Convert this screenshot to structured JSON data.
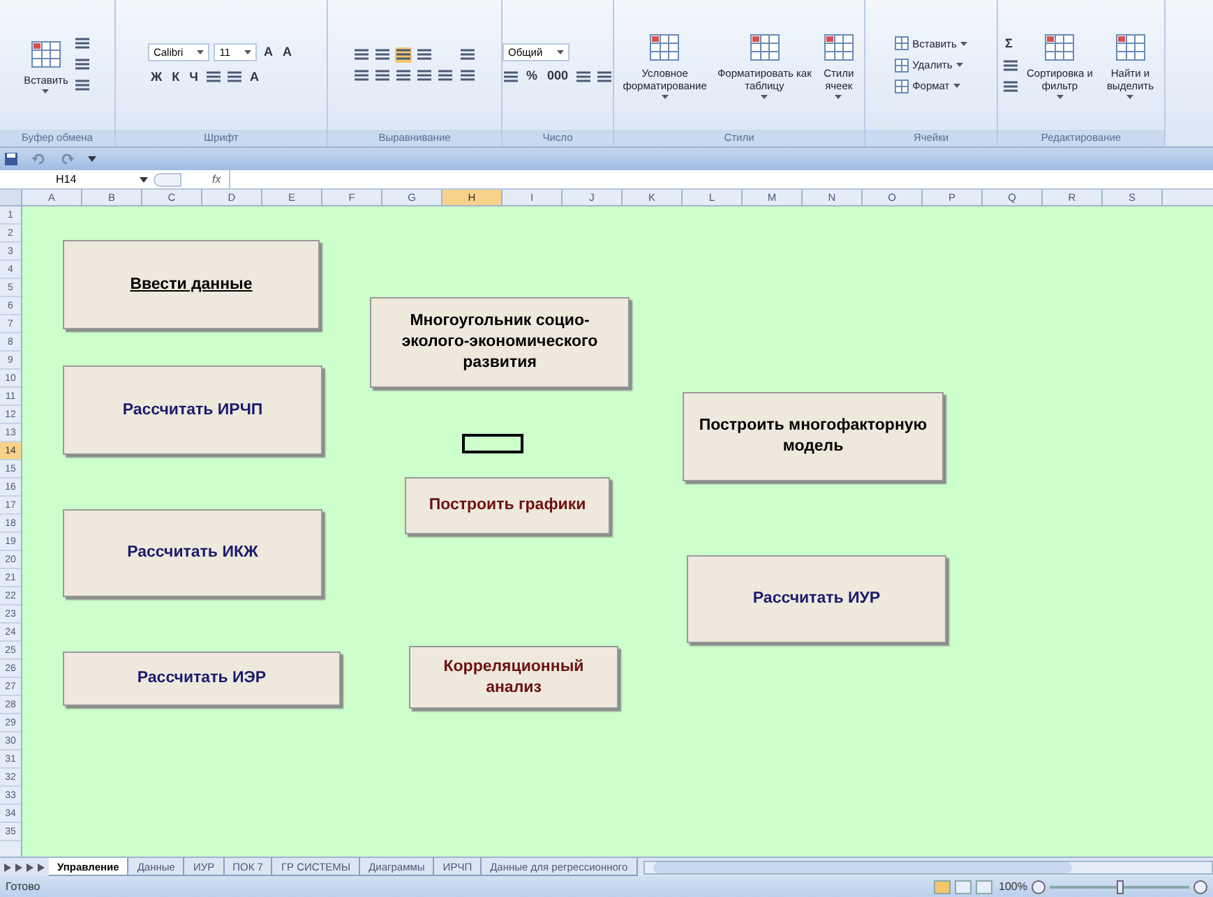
{
  "ribbon": {
    "groups": [
      {
        "label": "Буфер обмена",
        "parts": [
          {
            "kind": "large",
            "label": "Вставить"
          },
          {
            "kind": "stack",
            "lines": [
              {
                "items": [
                  {
                    "kind": "icon"
                  }
                ]
              },
              {
                "items": [
                  {
                    "kind": "icon"
                  }
                ]
              },
              {
                "items": [
                  {
                    "kind": "icon"
                  }
                ]
              }
            ]
          }
        ]
      },
      {
        "label": "Шрифт",
        "parts": [
          {
            "kind": "stack",
            "lines": [
              {
                "items": [
                  {
                    "kind": "field",
                    "value": "Calibri"
                  },
                  {
                    "kind": "field",
                    "value": "11"
                  },
                  {
                    "kind": "glyph",
                    "text": "A"
                  },
                  {
                    "kind": "glyph",
                    "text": "A"
                  }
                ]
              },
              {
                "items": [
                  {
                    "kind": "glyph",
                    "text": "Ж"
                  },
                  {
                    "kind": "glyph",
                    "text": "К"
                  },
                  {
                    "kind": "glyph",
                    "text": "Ч"
                  },
                  {
                    "kind": "icon"
                  },
                  {
                    "kind": "icon"
                  },
                  {
                    "kind": "glyph",
                    "text": "A"
                  }
                ]
              }
            ]
          }
        ]
      },
      {
        "label": "Выравнивание",
        "parts": [
          {
            "kind": "stack",
            "lines": [
              {
                "items": [
                  {
                    "kind": "icon",
                    "selected": false
                  },
                  {
                    "kind": "icon",
                    "selected": false
                  },
                  {
                    "kind": "icon",
                    "selected": true
                  },
                  {
                    "kind": "icon",
                    "selected": false
                  }
                ]
              },
              {
                "items": [
                  {
                    "kind": "icon"
                  },
                  {
                    "kind": "icon"
                  },
                  {
                    "kind": "icon"
                  },
                  {
                    "kind": "icon"
                  },
                  {
                    "kind": "icon"
                  }
                ]
              }
            ]
          },
          {
            "kind": "stack",
            "lines": [
              {
                "items": [
                  {
                    "kind": "icon"
                  }
                ]
              },
              {
                "items": [
                  {
                    "kind": "icon"
                  }
                ]
              }
            ]
          }
        ]
      },
      {
        "label": "Число",
        "parts": [
          {
            "kind": "stack",
            "lines": [
              {
                "items": [
                  {
                    "kind": "field",
                    "value": "Общий"
                  }
                ]
              },
              {
                "items": [
                  {
                    "kind": "icon"
                  },
                  {
                    "kind": "glyph",
                    "text": "%"
                  },
                  {
                    "kind": "glyph",
                    "text": "000"
                  },
                  {
                    "kind": "icon"
                  },
                  {
                    "kind": "icon"
                  }
                ]
              }
            ]
          }
        ]
      },
      {
        "label": "Стили",
        "parts": [
          {
            "kind": "large",
            "label": "Условное форматирование"
          },
          {
            "kind": "large",
            "label": "Форматировать как таблицу"
          },
          {
            "kind": "large",
            "label": "Стили ячеек"
          }
        ]
      },
      {
        "label": "Ячейки",
        "parts": [
          {
            "kind": "stack",
            "lines": [
              {
                "items": [
                  {
                    "kind": "small",
                    "label": "Вставить"
                  }
                ]
              },
              {
                "items": [
                  {
                    "kind": "small",
                    "label": "Удалить"
                  }
                ]
              },
              {
                "items": [
                  {
                    "kind": "small",
                    "label": "Формат"
                  }
                ]
              }
            ]
          }
        ]
      },
      {
        "label": "Редактирование",
        "parts": [
          {
            "kind": "stack",
            "lines": [
              {
                "items": [
                  {
                    "kind": "glyph",
                    "text": "Σ"
                  }
                ]
              },
              {
                "items": [
                  {
                    "kind": "icon"
                  }
                ]
              },
              {
                "items": [
                  {
                    "kind": "icon"
                  }
                ]
              }
            ]
          },
          {
            "kind": "large",
            "label": "Сортировка и фильтр"
          },
          {
            "kind": "large",
            "label": "Найти и выделить"
          }
        ]
      }
    ]
  },
  "formula_bar": {
    "name_box": "H14",
    "fx": "fx"
  },
  "columns": [
    {
      "label": "A",
      "selected": false
    },
    {
      "label": "B",
      "selected": false
    },
    {
      "label": "C",
      "selected": false
    },
    {
      "label": "D",
      "selected": false
    },
    {
      "label": "E",
      "selected": false
    },
    {
      "label": "F",
      "selected": false
    },
    {
      "label": "G",
      "selected": false
    },
    {
      "label": "H",
      "selected": true
    },
    {
      "label": "I",
      "selected": false
    },
    {
      "label": "J",
      "selected": false
    },
    {
      "label": "K",
      "selected": false
    },
    {
      "label": "L",
      "selected": false
    },
    {
      "label": "M",
      "selected": false
    },
    {
      "label": "N",
      "selected": false
    },
    {
      "label": "O",
      "selected": false
    },
    {
      "label": "P",
      "selected": false
    },
    {
      "label": "Q",
      "selected": false
    },
    {
      "label": "R",
      "selected": false
    },
    {
      "label": "S",
      "selected": false
    }
  ],
  "rows": [
    {
      "label": "1",
      "selected": false
    },
    {
      "label": "2",
      "selected": false
    },
    {
      "label": "3",
      "selected": false
    },
    {
      "label": "4",
      "selected": false
    },
    {
      "label": "5",
      "selected": false
    },
    {
      "label": "6",
      "selected": false
    },
    {
      "label": "7",
      "selected": false
    },
    {
      "label": "8",
      "selected": false
    },
    {
      "label": "9",
      "selected": false
    },
    {
      "label": "10",
      "selected": false
    },
    {
      "label": "11",
      "selected": false
    },
    {
      "label": "12",
      "selected": false
    },
    {
      "label": "13",
      "selected": false
    },
    {
      "label": "14",
      "selected": true
    },
    {
      "label": "15",
      "selected": false
    },
    {
      "label": "16",
      "selected": false
    },
    {
      "label": "17",
      "selected": false
    },
    {
      "label": "18",
      "selected": false
    },
    {
      "label": "19",
      "selected": false
    },
    {
      "label": "20",
      "selected": false
    },
    {
      "label": "21",
      "selected": false
    },
    {
      "label": "22",
      "selected": false
    },
    {
      "label": "23",
      "selected": false
    },
    {
      "label": "24",
      "selected": false
    },
    {
      "label": "25",
      "selected": false
    },
    {
      "label": "26",
      "selected": false
    },
    {
      "label": "27",
      "selected": false
    },
    {
      "label": "28",
      "selected": false
    },
    {
      "label": "29",
      "selected": false
    },
    {
      "label": "30",
      "selected": false
    },
    {
      "label": "31",
      "selected": false
    },
    {
      "label": "32",
      "selected": false
    },
    {
      "label": "33",
      "selected": false
    },
    {
      "label": "34",
      "selected": false
    },
    {
      "label": "35",
      "selected": false
    }
  ],
  "sheet_buttons": [
    {
      "text": "Ввести данные",
      "color": "#000000",
      "underlined": true
    },
    {
      "text": "Рассчитать ИРЧП",
      "color": "#1a1a6e",
      "underlined": false
    },
    {
      "text": "Рассчитать ИКЖ",
      "color": "#1a1a6e",
      "underlined": false
    },
    {
      "text": "Рассчитать ИЭР",
      "color": "#1a1a6e",
      "underlined": false
    },
    {
      "text": "Многоугольник социо-эколого-экономического развития",
      "color": "#000000",
      "underlined": false
    },
    {
      "text": "Построить графики",
      "color": "#6e1010",
      "underlined": false
    },
    {
      "text": "Корреляционный анализ",
      "color": "#6e1010",
      "underlined": false
    },
    {
      "text": "Построить многофакторную модель",
      "color": "#000000",
      "underlined": false
    },
    {
      "text": "Рассчитать ИУР",
      "color": "#1a1a6e",
      "underlined": false
    }
  ],
  "sheet_tabs": [
    {
      "label": "Управление",
      "selected": true
    },
    {
      "label": "Данные",
      "selected": false
    },
    {
      "label": "ИУР",
      "selected": false
    },
    {
      "label": "ПОК 7",
      "selected": false
    },
    {
      "label": "ГР СИСТЕМЫ",
      "selected": false
    },
    {
      "label": "Диаграммы",
      "selected": false
    },
    {
      "label": "ИРЧП",
      "selected": false
    },
    {
      "label": "Данные для регрессионного",
      "selected": false
    }
  ],
  "status_bar": {
    "status": "Готово",
    "zoom": {
      "reading": "100%",
      "level": 0.5
    }
  }
}
